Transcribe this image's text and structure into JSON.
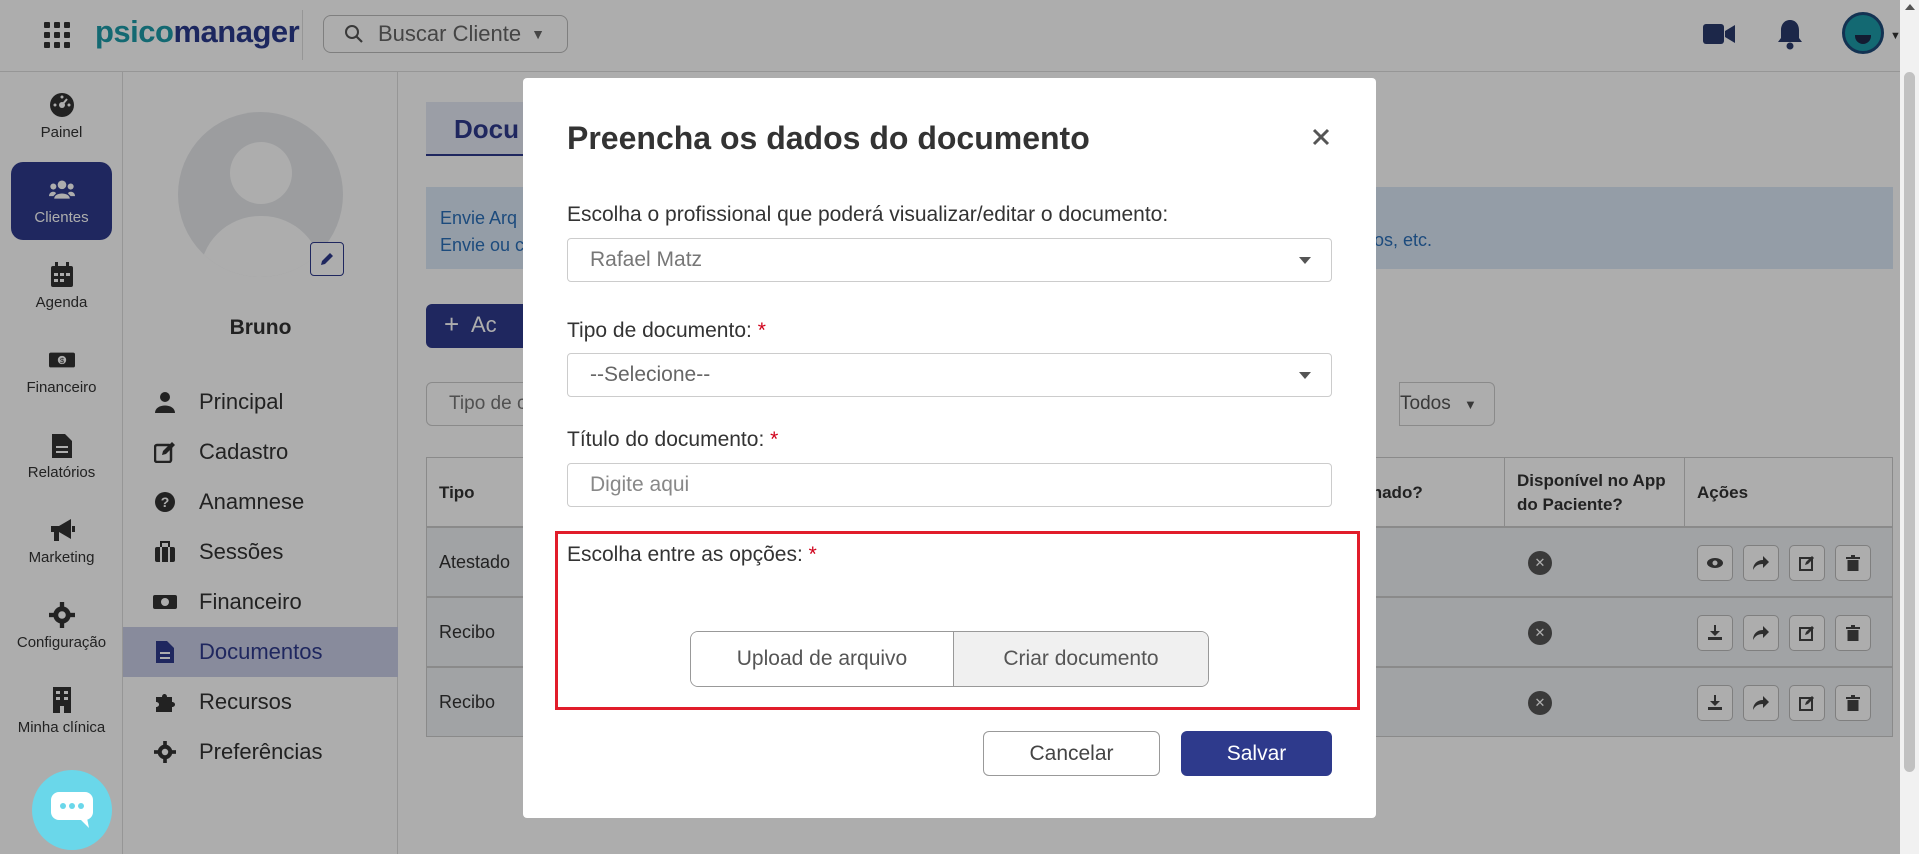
{
  "topbar": {
    "logo_part1": "psico",
    "logo_part2": "manager",
    "search_label": "Buscar Cliente"
  },
  "leftnav": [
    {
      "label": "Painel",
      "icon": "dashboard-icon"
    },
    {
      "label": "Clientes",
      "icon": "users-icon",
      "active": true
    },
    {
      "label": "Agenda",
      "icon": "calendar-icon"
    },
    {
      "label": "Financeiro",
      "icon": "money-icon"
    },
    {
      "label": "Relatórios",
      "icon": "file-icon"
    },
    {
      "label": "Marketing",
      "icon": "megaphone-icon"
    },
    {
      "label": "Configuração",
      "icon": "gear-icon"
    },
    {
      "label": "Minha clínica",
      "icon": "building-icon"
    }
  ],
  "profile": {
    "name": "Bruno"
  },
  "client_menu": [
    {
      "label": "Principal",
      "icon": "user-icon"
    },
    {
      "label": "Cadastro",
      "icon": "edit-icon"
    },
    {
      "label": "Anamnese",
      "icon": "question-icon"
    },
    {
      "label": "Sessões",
      "icon": "briefcase-icon"
    },
    {
      "label": "Financeiro",
      "icon": "money-icon"
    },
    {
      "label": "Documentos",
      "icon": "file-icon",
      "active": true
    },
    {
      "label": "Recursos",
      "icon": "puzzle-icon"
    },
    {
      "label": "Preferências",
      "icon": "gear-icon"
    }
  ],
  "main": {
    "tab_label": "Docu",
    "info_line1": "Envie Arq",
    "info_line2": "Envie ou c",
    "info_tail": "os, etc.",
    "add_button_label": "Ac",
    "filter_left": "Tipo de c",
    "filter_right": "Todos",
    "table": {
      "headers": [
        "Tipo",
        "inado?",
        "Disponível no App do Paciente?",
        "Ações"
      ],
      "rows": [
        {
          "tipo": "Atestado"
        },
        {
          "tipo": "Recibo"
        },
        {
          "tipo": "Recibo"
        }
      ]
    }
  },
  "modal": {
    "title": "Preencha os dados do documento",
    "professional_label": "Escolha o profissional que poderá visualizar/editar o documento:",
    "professional_value": "Rafael Matz",
    "doc_type_label": "Tipo de documento:",
    "doc_type_value": "--Selecione--",
    "doc_title_label": "Título do documento:",
    "doc_title_placeholder": "Digite aqui",
    "options_label": "Escolha entre as opções:",
    "required_mark": "*",
    "option_upload": "Upload de arquivo",
    "option_create": "Criar documento",
    "cancel_label": "Cancelar",
    "save_label": "Salvar"
  },
  "colors": {
    "brand_primary": "#2e3a8c",
    "brand_teal": "#1c9ba9",
    "required": "#d0021b",
    "highlight": "#e11d2a"
  }
}
